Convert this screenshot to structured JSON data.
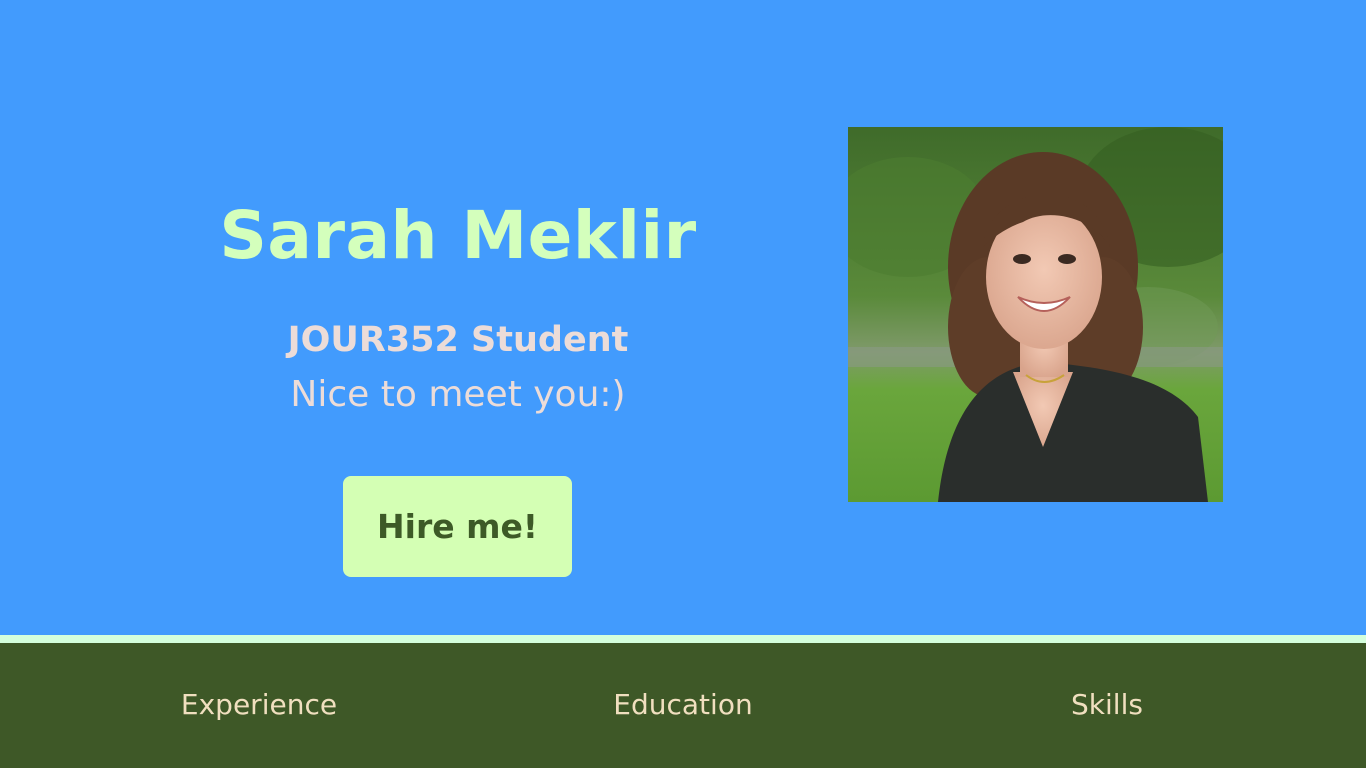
{
  "hero": {
    "name": "Sarah Meklir",
    "subtitle": "JOUR352 Student",
    "tagline": "Nice to meet you:)",
    "cta_label": "Hire me!"
  },
  "portrait": {
    "icon": "profile-photo"
  },
  "nav": {
    "items": [
      {
        "label": "Experience"
      },
      {
        "label": "Education"
      },
      {
        "label": "Skills"
      }
    ]
  },
  "colors": {
    "hero_bg": "#429bfd",
    "accent_green": "#d4ffbc",
    "footer_bg": "#3e5827",
    "footer_text": "#f0dfbf"
  }
}
